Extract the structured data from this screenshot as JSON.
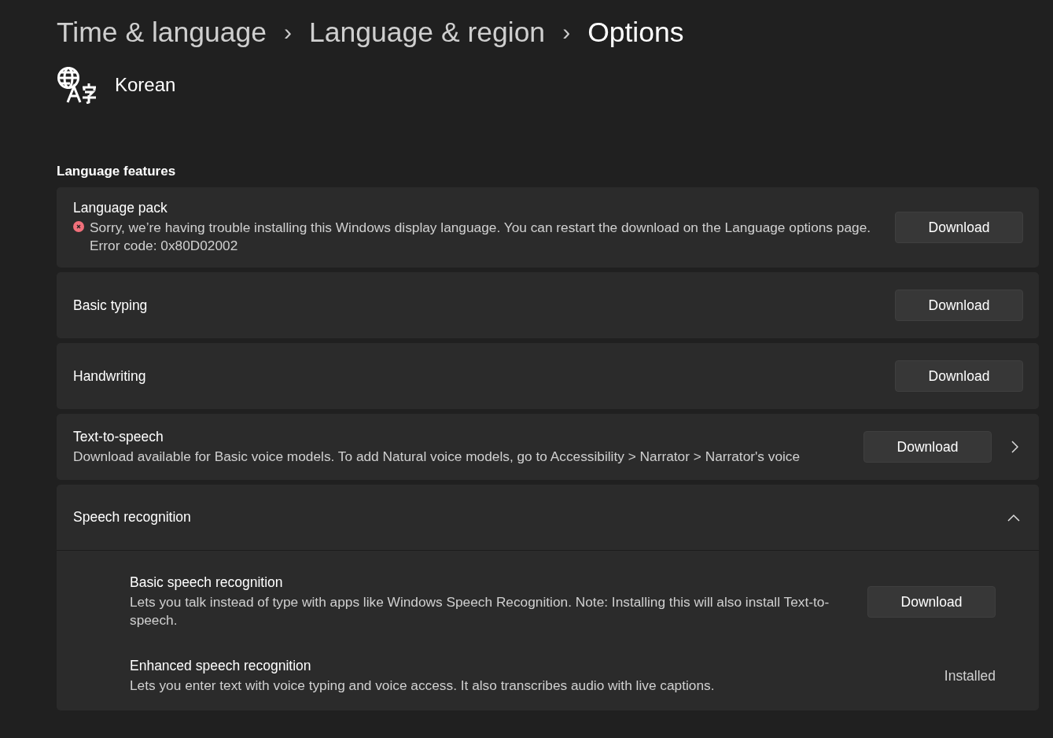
{
  "breadcrumb": [
    {
      "label": "Time & language",
      "current": false
    },
    {
      "label": "Language & region",
      "current": false
    },
    {
      "label": "Options",
      "current": true
    }
  ],
  "separator": "›",
  "language": {
    "name": "Korean"
  },
  "section_title": "Language features",
  "features": [
    {
      "title": "Language pack",
      "error": "Sorry, we’re having trouble installing this Windows display language. You can restart the download on the Language options page. Error code: 0x80D02002",
      "action": {
        "kind": "button",
        "label": "Download"
      },
      "navigable": false
    },
    {
      "title": "Basic typing",
      "action": {
        "kind": "button",
        "label": "Download"
      },
      "navigable": false
    },
    {
      "title": "Handwriting",
      "action": {
        "kind": "button",
        "label": "Download"
      },
      "navigable": false
    },
    {
      "title": "Text-to-speech",
      "description": "Download available for Basic voice models. To add Natural voice models, go to Accessibility > Narrator > Narrator's voice",
      "action": {
        "kind": "button",
        "label": "Download"
      },
      "navigable": true
    },
    {
      "title": "Speech recognition",
      "navigable": false,
      "expanded": true,
      "children": [
        {
          "title": "Basic speech recognition",
          "description": "Lets you talk instead of type with apps like Windows Speech Recognition. Note: Installing this will also install Text-to-speech.",
          "action": {
            "kind": "button",
            "label": "Download"
          }
        },
        {
          "title": "Enhanced speech recognition",
          "description": "Lets you enter text with voice typing and voice access. It also transcribes audio with live captions.",
          "action": {
            "kind": "status",
            "text": "Installed"
          }
        }
      ]
    }
  ]
}
